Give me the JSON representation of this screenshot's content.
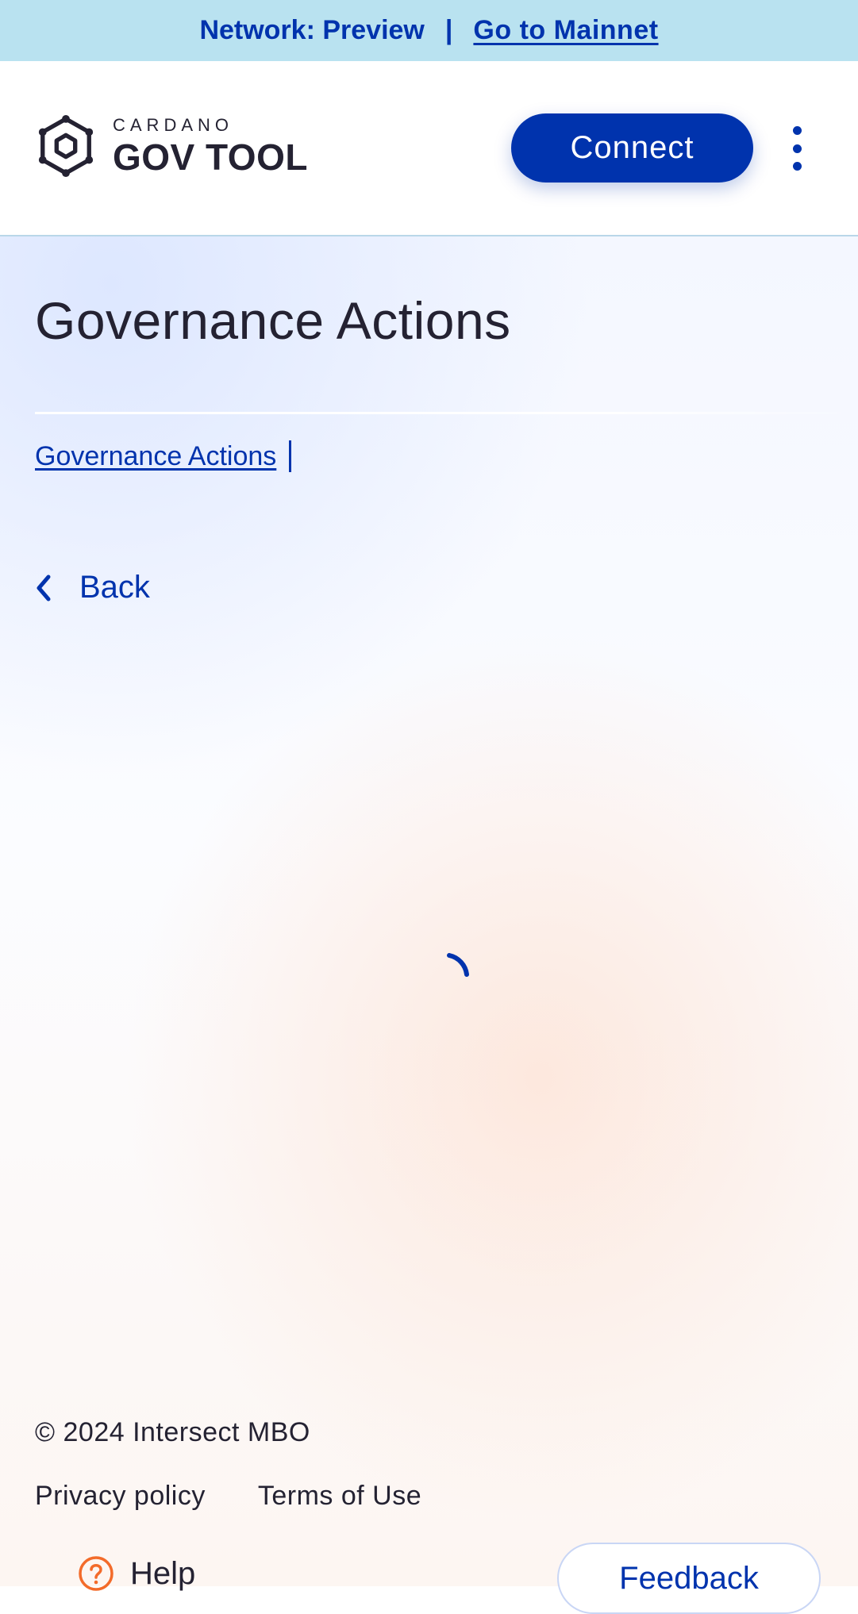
{
  "banner": {
    "network_text": "Network: Preview",
    "separator": "|",
    "mainnet_link": "Go to Mainnet"
  },
  "header": {
    "logo_small": "CARDANO",
    "logo_big": "GOV TOOL",
    "logo_icon": "cardano-hexagon-logo",
    "connect_label": "Connect",
    "menu_icon": "vertical-dots-icon"
  },
  "main": {
    "title": "Governance Actions",
    "breadcrumb": {
      "items": [
        "Governance Actions"
      ]
    },
    "back_label": "Back",
    "back_icon": "chevron-left-icon",
    "loading_icon": "spinner-icon"
  },
  "footer": {
    "copyright": "© 2024 Intersect MBO",
    "links": [
      "Privacy policy",
      "Terms of Use"
    ],
    "help_label": "Help",
    "help_icon": "question-circle-icon",
    "feedback_label": "Feedback"
  },
  "colors": {
    "primary": "#0033ad",
    "banner_bg": "#b9e2f0",
    "text": "#242232",
    "help_accent": "#f36b2a"
  }
}
